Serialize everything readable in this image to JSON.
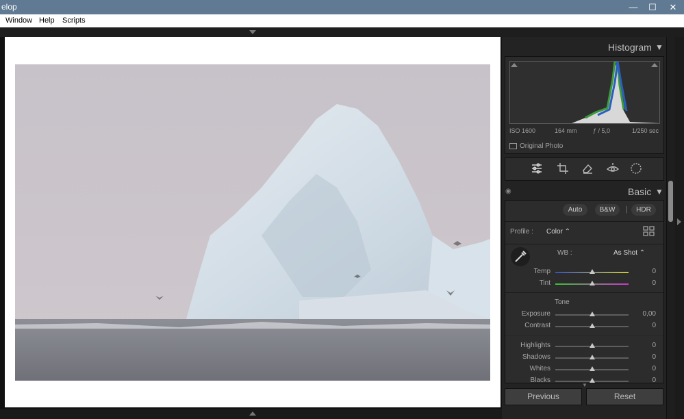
{
  "window": {
    "title": "elop",
    "minimize": "—",
    "maximize": "☐",
    "close": "✕"
  },
  "menu": {
    "items": [
      "Window",
      "Help",
      "Scripts"
    ]
  },
  "histogram": {
    "title": "Histogram",
    "iso": "ISO 1600",
    "focal": "164 mm",
    "aperture": "ƒ / 5,0",
    "shutter": "1/250 sec",
    "original_photo_label": "Original Photo"
  },
  "basic": {
    "title": "Basic",
    "buttons": {
      "auto": "Auto",
      "bw": "B&W",
      "hdr": "HDR"
    },
    "profile_label": "Profile :",
    "profile_value": "Color ⌃",
    "wb_label": "WB :",
    "wb_value": "As Shot ⌃",
    "tone_label": "Tone",
    "sliders": [
      {
        "label": "Temp",
        "value": "0",
        "position": 0.5
      },
      {
        "label": "Tint",
        "value": "0",
        "position": 0.5
      },
      {
        "label": "Exposure",
        "value": "0,00",
        "position": 0.5
      },
      {
        "label": "Contrast",
        "value": "0",
        "position": 0.5
      },
      {
        "label": "Highlights",
        "value": "0",
        "position": 0.5
      },
      {
        "label": "Shadows",
        "value": "0",
        "position": 0.5
      },
      {
        "label": "Whites",
        "value": "0",
        "position": 0.5
      },
      {
        "label": "Blacks",
        "value": "0",
        "position": 0.5
      }
    ]
  },
  "footer": {
    "previous": "Previous",
    "reset": "Reset"
  }
}
